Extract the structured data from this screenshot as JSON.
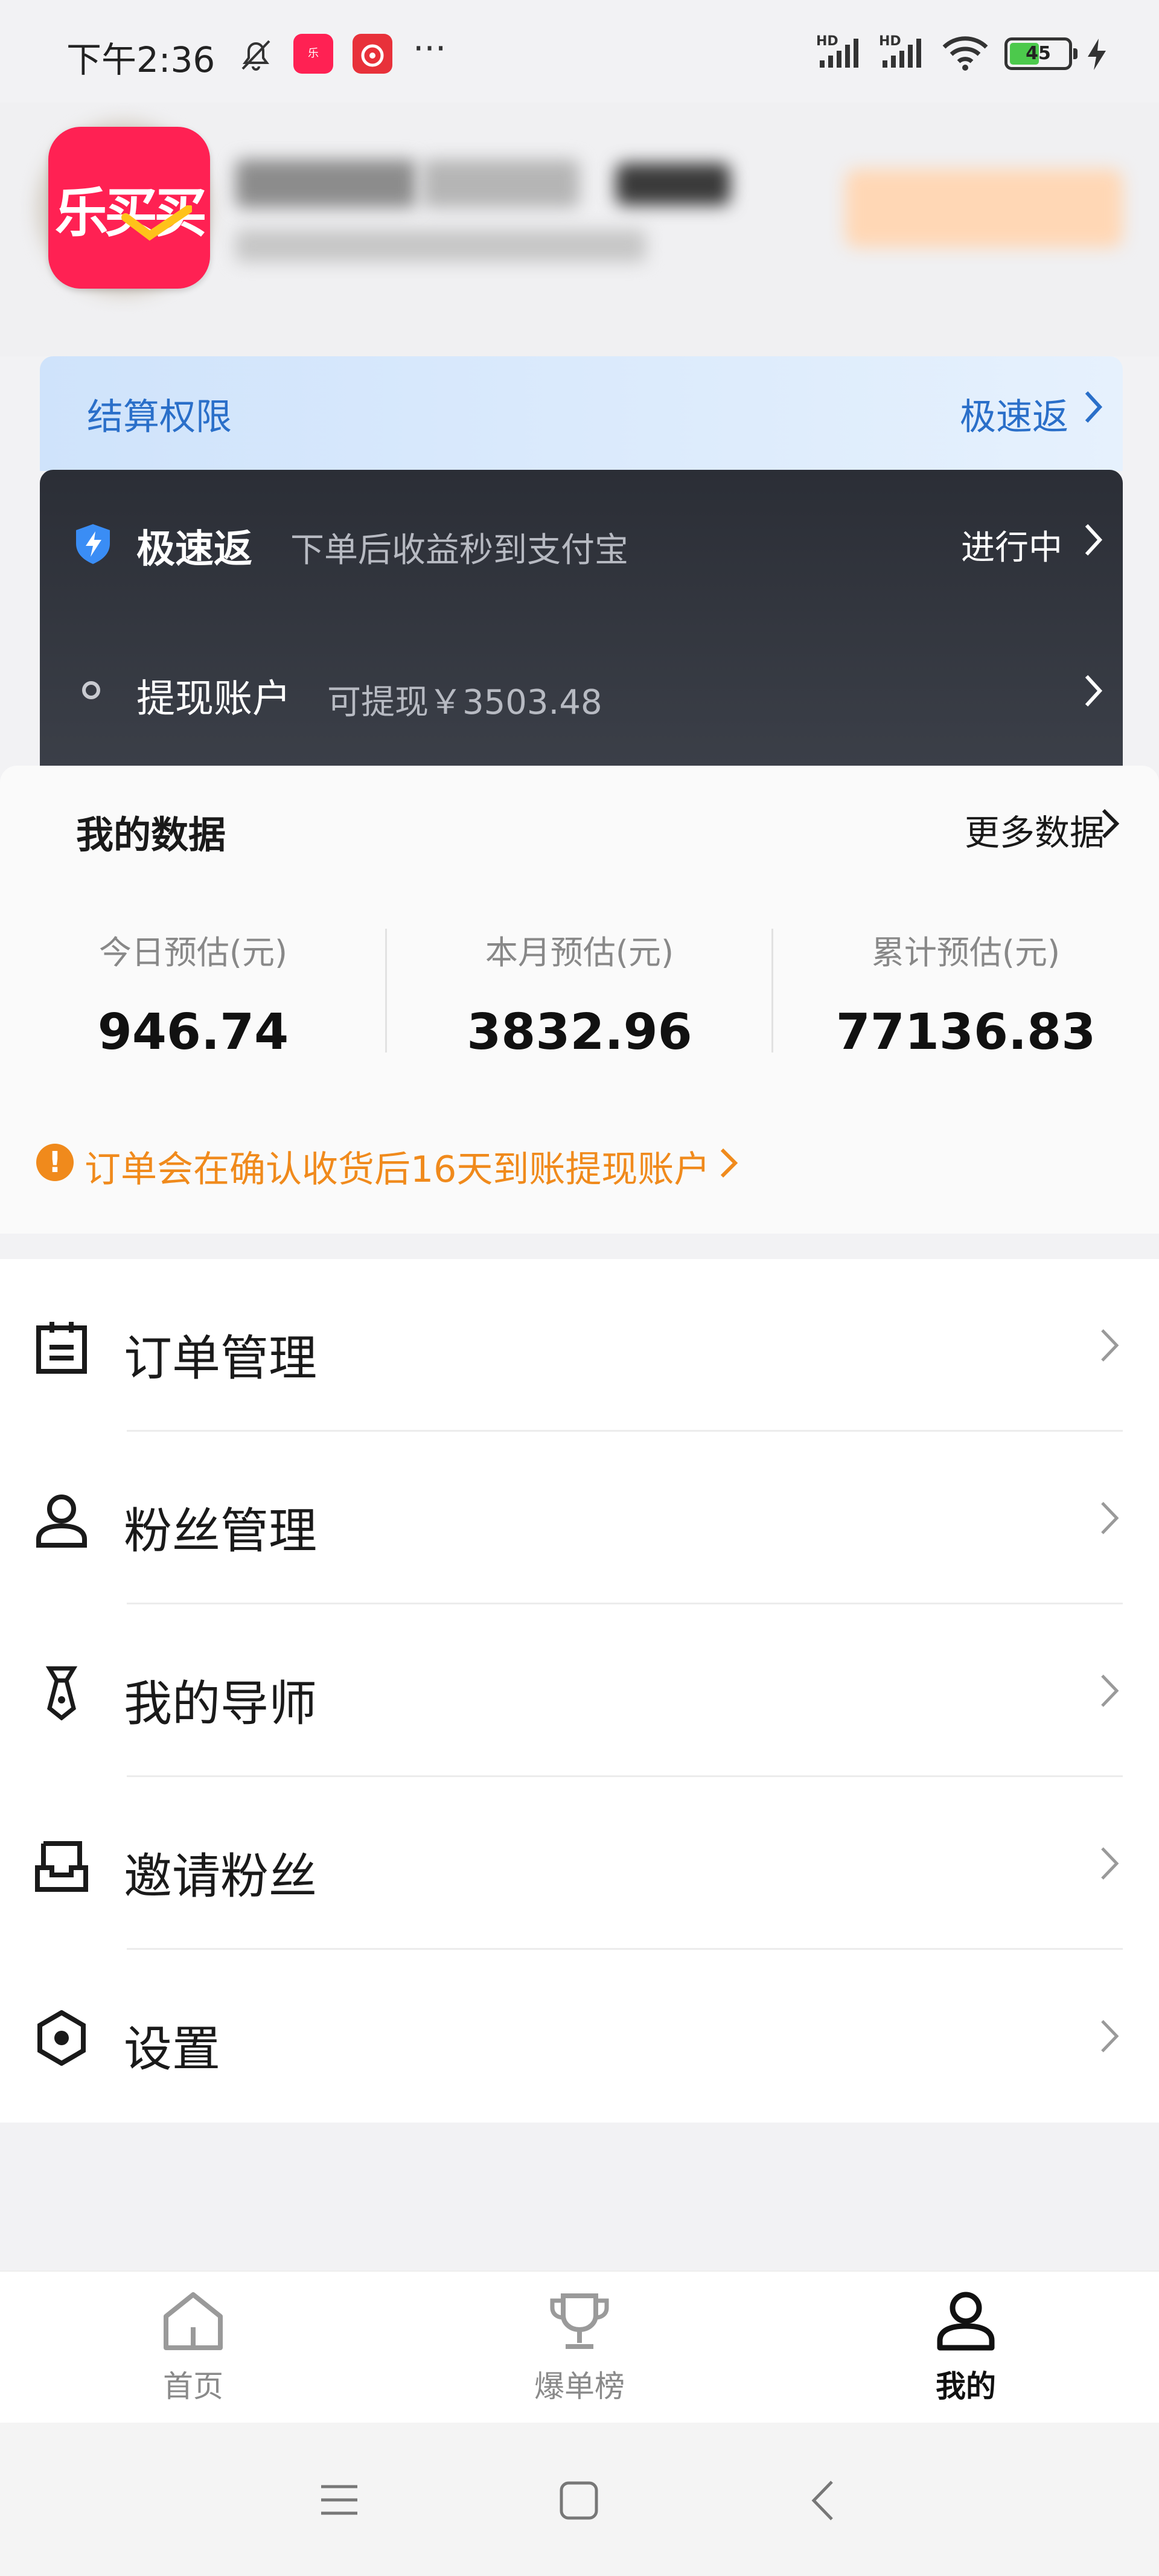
{
  "status_bar": {
    "time": "下午2:36",
    "more": "···",
    "battery": "45",
    "signal_label": "HD"
  },
  "app_logo": {
    "text": "乐买买",
    "brand_color": "#ff2153"
  },
  "settlement": {
    "title": "结算权限",
    "link": "极速返",
    "fast_return": {
      "title": "极速返",
      "description": "下单后收益秒到支付宝",
      "status": "进行中"
    },
    "withdraw": {
      "title": "提现账户",
      "description": "可提现￥3503.48"
    }
  },
  "my_data": {
    "title": "我的数据",
    "more": "更多数据",
    "stats": [
      {
        "label": "今日预估(元)",
        "value": "946.74"
      },
      {
        "label": "本月预估(元)",
        "value": "3832.96"
      },
      {
        "label": "累计预估(元)",
        "value": "77136.83"
      }
    ],
    "notice_icon": "!",
    "notice": "订单会在确认收货后16天到账提现账户"
  },
  "menu": [
    {
      "label": "订单管理",
      "icon": "clipboard-icon"
    },
    {
      "label": "粉丝管理",
      "icon": "person-icon"
    },
    {
      "label": "我的导师",
      "icon": "tie-icon"
    },
    {
      "label": "邀请粉丝",
      "icon": "inbox-icon"
    },
    {
      "label": "设置",
      "icon": "gear-icon"
    }
  ],
  "tabs": [
    {
      "label": "首页",
      "icon": "home-icon",
      "active": false
    },
    {
      "label": "爆单榜",
      "icon": "trophy-icon",
      "active": false
    },
    {
      "label": "我的",
      "icon": "profile-icon",
      "active": true
    }
  ],
  "colors": {
    "accent_blue": "#2a6fc9",
    "warning_orange": "#f08a1c",
    "dark_card": "#2b2e36"
  }
}
